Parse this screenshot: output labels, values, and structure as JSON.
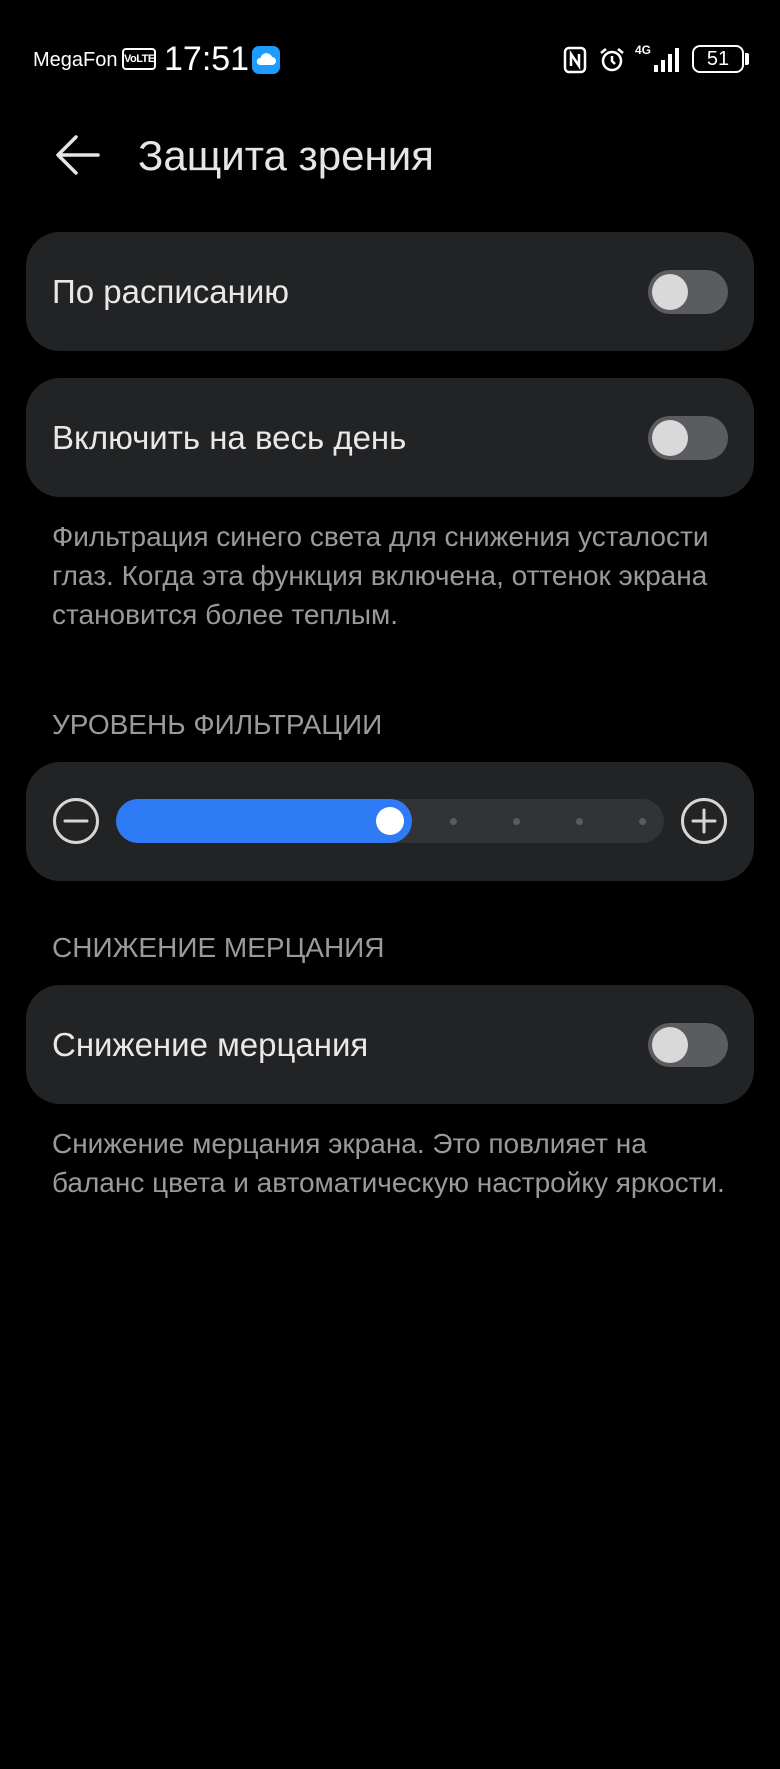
{
  "status_bar": {
    "carrier": "MegaFon",
    "volte": "VoLTE",
    "time": "17:51",
    "network": "4G",
    "battery": "51",
    "icons": [
      "cloud-icon",
      "nfc-icon",
      "alarm-icon",
      "signal-icon",
      "battery-icon"
    ]
  },
  "header": {
    "title": "Защита зрения",
    "back_icon": "arrow-left-icon"
  },
  "schedule": {
    "label": "По расписанию",
    "enabled": false
  },
  "all_day": {
    "label": "Включить на весь день",
    "enabled": false
  },
  "eye_comfort_description": "Фильтрация синего света для снижения усталости глаз. Когда эта функция включена, оттенок экрана становится более теплым.",
  "filter_level": {
    "section_title": "УРОВЕНЬ ФИЛЬТРАЦИИ",
    "value_fraction": 0.5,
    "steps": 9,
    "minus_icon": "minus-circle-icon",
    "plus_icon": "plus-circle-icon"
  },
  "flicker": {
    "section_title": "СНИЖЕНИЕ МЕРЦАНИЯ",
    "label": "Снижение мерцания",
    "enabled": false,
    "description": "Снижение мерцания экрана. Это повлияет на баланс цвета и автоматическую настройку яркости."
  },
  "colors": {
    "background": "#000000",
    "card": "#222325",
    "accent": "#2f7bf5",
    "toggle_off": "#5b5c5f",
    "secondary_text": "#9a9a9a"
  }
}
